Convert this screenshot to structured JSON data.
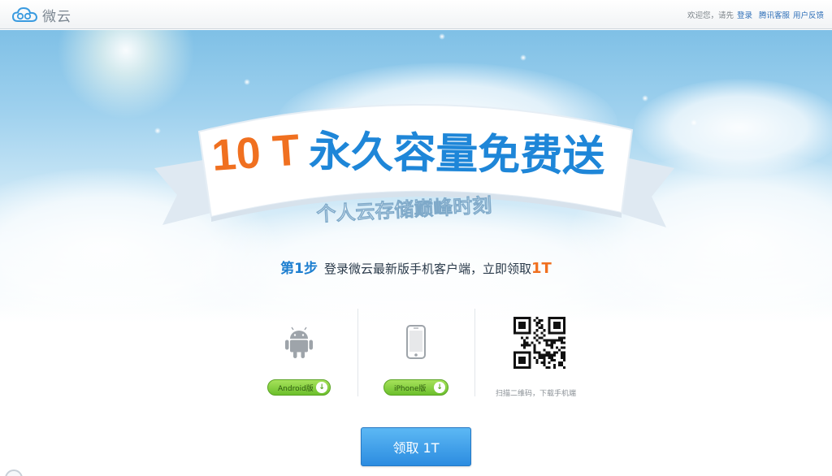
{
  "header": {
    "logo_text": "微云",
    "logo_icon": "cloud-icon",
    "greeting": "欢迎您，请先",
    "login_link": "登录",
    "service_link": "腾讯客服",
    "feedback_link": "用户反馈"
  },
  "hero": {
    "banner_highlight": "10 T",
    "banner_title": "永久容量免费送",
    "banner_subtitle": "个人云存储巅峰时刻"
  },
  "step": {
    "num": "第1步",
    "text": "登录微云最新版手机客户端，立即领取",
    "highlight": "1T"
  },
  "downloads": {
    "android_label": "Android版",
    "iphone_label": "iPhone版",
    "qr_caption": "扫描二维码，下载手机端",
    "android_icon": "android-icon",
    "iphone_icon": "iphone-icon",
    "qr_icon": "qr-code-icon"
  },
  "cta": {
    "label": "领取 1T"
  },
  "colors": {
    "accent_blue": "#1e7fd0",
    "accent_orange": "#f07020",
    "download_green": "#6cbf2c",
    "cta_blue": "#2c8ce0"
  }
}
